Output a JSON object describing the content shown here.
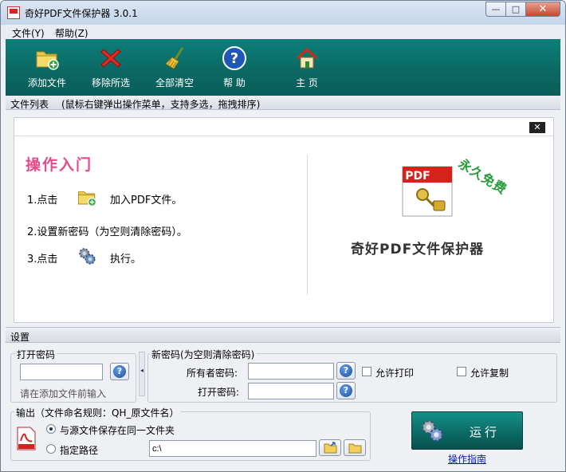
{
  "window": {
    "title": "奇好PDF文件保护器 3.0.1",
    "controls": {
      "minimize": "—",
      "maximize": "□",
      "close": "✕"
    }
  },
  "menu": {
    "file": "文件(Y)",
    "help": "帮助(Z)"
  },
  "toolbar": {
    "items": [
      {
        "label": "添加文件",
        "icon": "add-folder-icon"
      },
      {
        "label": "移除所选",
        "icon": "red-x-icon"
      },
      {
        "label": "全部清空",
        "icon": "broom-icon"
      },
      {
        "label": "帮 助",
        "icon": "help-icon"
      },
      {
        "label": "主 页",
        "icon": "home-icon"
      }
    ]
  },
  "file_list": {
    "label": "文件列表",
    "hint": "(鼠标右键弹出操作菜单，支持多选，拖拽排序)"
  },
  "guide": {
    "close": "✕",
    "title": "操作入门",
    "step1_prefix": "1.点击",
    "step1_suffix": "加入PDF文件。",
    "step2": "2.设置新密码（为空则清除密码）。",
    "step3_prefix": "3.点击",
    "step3_suffix": "执行。",
    "free_badge": "永久免费",
    "logo_text": "PDF",
    "product_name": "奇好PDF文件保护器"
  },
  "settings": {
    "label": "设置",
    "open_password": {
      "legend": "打开密码",
      "value": "",
      "hint": "请在添加文件前输入"
    },
    "new_password": {
      "legend": "新密码(为空则清除密码)",
      "owner_label": "所有者密码:",
      "owner_value": "",
      "open_label": "打开密码:",
      "open_value": "",
      "allow_print": "允许打印",
      "allow_copy": "允许复制"
    },
    "output": {
      "legend": "输出（文件命名规则：QH_原文件名）",
      "option_same": "与源文件保存在同一文件夹",
      "option_custom": "指定路径",
      "path": "c:\\"
    },
    "run_label": "运行",
    "help_link": "操作指南"
  },
  "colors": {
    "toolbar_bg": "#0b6762",
    "guide_title": "#e64a8a",
    "free_badge": "#2a9a3a",
    "link": "#0b1fa8"
  }
}
